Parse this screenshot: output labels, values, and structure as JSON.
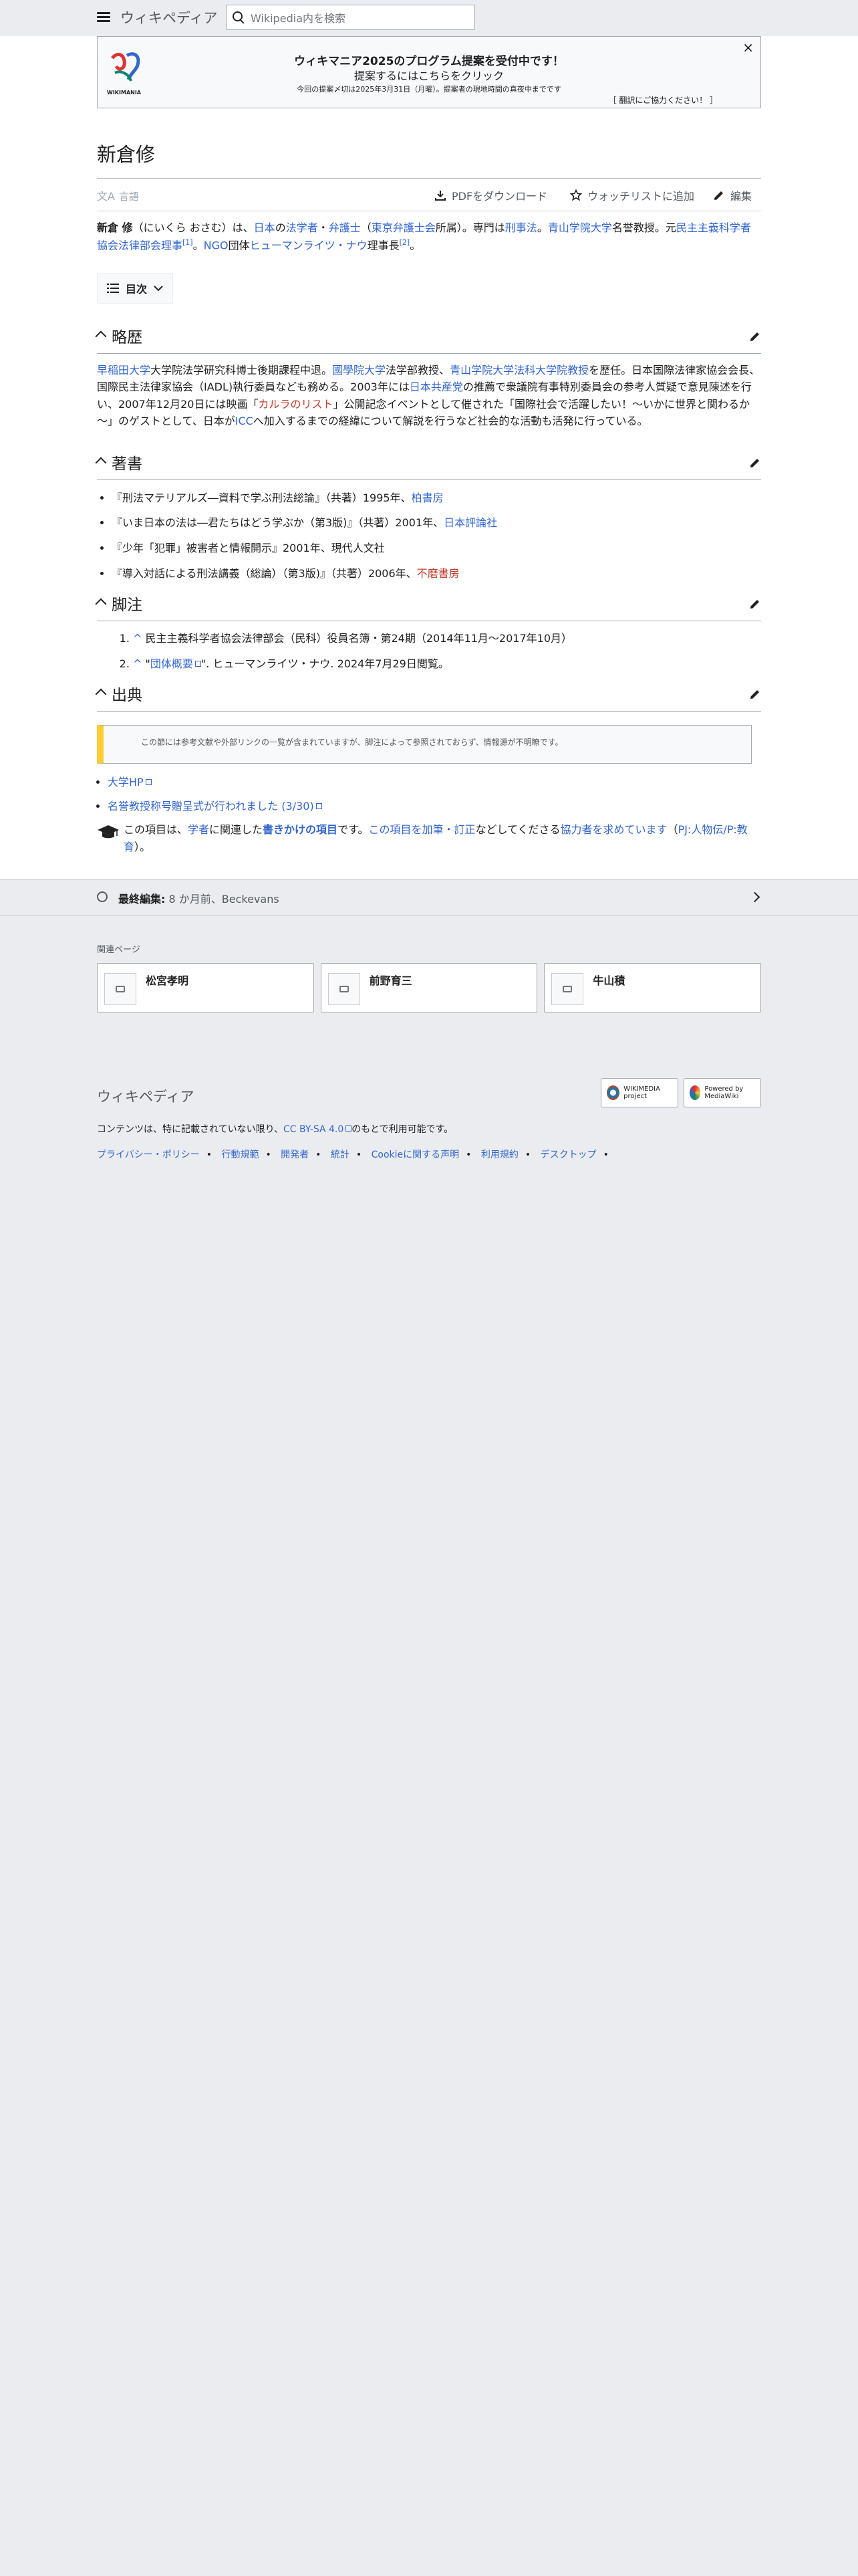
{
  "header": {
    "logo": "ウィキペディア",
    "search_placeholder": "Wikipedia内を検索"
  },
  "banner": {
    "logo_text": "WIKIMANIA",
    "title": "ウィキマニア2025のプログラム提案を受付中です！",
    "subtitle": "提案するにはこちらをクリック",
    "note": "今回の提案〆切は2025年3月31日（月曜）。提案者の現地時間の真夜中までです",
    "help": "［ 翻訳にご協力ください！ ］",
    "close": "×"
  },
  "title": "新倉修",
  "toolbar": {
    "language": "言語",
    "pdf": "PDFをダウンロード",
    "watch": "ウォッチリストに追加",
    "edit": "編集"
  },
  "lead": {
    "name": "新倉 修",
    "reading": "（にいくら おさむ）は、",
    "l_japan": "日本",
    "t1": "の",
    "l_jurist": "法学者",
    "t2": "・",
    "l_lawyer": "弁護士",
    "t3": "（",
    "l_bar": "東京弁護士会",
    "t4": "所属）。専門は",
    "l_criminal": "刑事法",
    "t5": "。",
    "l_aoyama": "青山学院大学",
    "t6": "名誉教授。元",
    "l_jdla": "民主主義科学者協会法律部会理事",
    "ref1": "[1]",
    "t7": "。",
    "l_ngo": "NGO",
    "t8": "団体",
    "l_hrn": "ヒューマンライツ・ナウ",
    "t9": "理事長",
    "ref2": "[2]",
    "t10": "。"
  },
  "toc": {
    "label": "目次"
  },
  "sections": {
    "career": {
      "heading": "略歴",
      "l_waseda": "早稲田大学",
      "t1": "大学院法学研究科博士後期課程中退。",
      "l_kokugakuin": "國學院大学",
      "t2": "法学部教授、",
      "l_aoyama_law": "青山学院大学法科大学院教授",
      "t3": "を歴任。日本国際法律家協会会長、国際民主法律家協会（IADL)執行委員なども務める。2003年には",
      "l_jcp": "日本共産党",
      "t4": "の推薦で衆議院有事特別委員会の参考人質疑で意見陳述を行い、2007年12月20日には映画「",
      "l_karla": "カルラのリスト",
      "t5": "」公開記念イベントとして催された「国際社会で活躍したい！～いかに世界と関わるか～」のゲストとして、日本が",
      "l_icc": "ICC",
      "t6": "へ加入するまでの経緯について解説を行うなど社会的な活動も活発に行っている。"
    },
    "works": {
      "heading": "著書",
      "items": [
        {
          "text": "『刑法マテリアルズ―資料で学ぶ刑法総論』（共著）1995年、",
          "link": "柏書房",
          "red": false
        },
        {
          "text": "『いま日本の法は―君たちはどう学ぶか（第3版)』（共著）2001年、",
          "link": "日本評論社",
          "red": false
        },
        {
          "text": "『少年「犯罪」被害者と情報開示』2001年、現代人文社",
          "link": "",
          "red": false
        },
        {
          "text": "『導入対話による刑法講義（総論）（第3版)』（共著）2006年、",
          "link": "不磨書房",
          "red": true
        }
      ]
    },
    "notes": {
      "heading": "脚注",
      "items": [
        {
          "caret": "^",
          "pre": " 民主主義科学者協会法律部会（民科）役員名簿・第24期（2014年11月〜2017年10月）",
          "link": "",
          "post": ""
        },
        {
          "caret": "^",
          "pre": " \"",
          "link": "団体概要",
          "post": "\". ヒューマンライツ・ナウ. 2024年7月29日閲覧。"
        }
      ]
    },
    "sources": {
      "heading": "出典",
      "ambox": "この節には参考文献や外部リンクの一覧が含まれていますが、脚注によって参照されておらず、情報源が不明瞭です。",
      "links": [
        "大学HP",
        "名誉教授称号贈呈式が行われました (3/30)"
      ],
      "stub": {
        "t1": "この項目は、",
        "l_scholar": "学者",
        "t2": "に関連した",
        "l_stub": "書きかけの項目",
        "t3": "です。",
        "l_expand": "この項目を加筆・訂正",
        "t4": "などしてくださる",
        "l_help": "協力者を求めています",
        "t5": "（",
        "l_portal": "PJ:人物伝/P:教育",
        "t6": "）。"
      }
    }
  },
  "last_edit": {
    "label": "最終編集:",
    "when": "8 か月前",
    "sep": "、",
    "user": "Beckevans"
  },
  "related": {
    "label": "関連ページ",
    "items": [
      "松宮孝明",
      "前野育三",
      "牛山積"
    ]
  },
  "footer": {
    "brand": "ウィキペディア",
    "badge1": "WIKIMEDIA project",
    "badge2": "Powered by MediaWiki",
    "license_pre": "コンテンツは、特に記載されていない限り、",
    "license_link": "CC BY-SA 4.0",
    "license_post": "のもとで利用可能です。",
    "links": [
      "プライバシー・ポリシー",
      "行動規範",
      "開発者",
      "統計",
      "Cookieに関する声明",
      "利用規約",
      "デスクトップ"
    ]
  },
  "colors": {
    "link": "#3366cc",
    "redlink": "#bf3c2c",
    "background": "#eaecf0",
    "ambox_accent": "#ffcc33"
  }
}
